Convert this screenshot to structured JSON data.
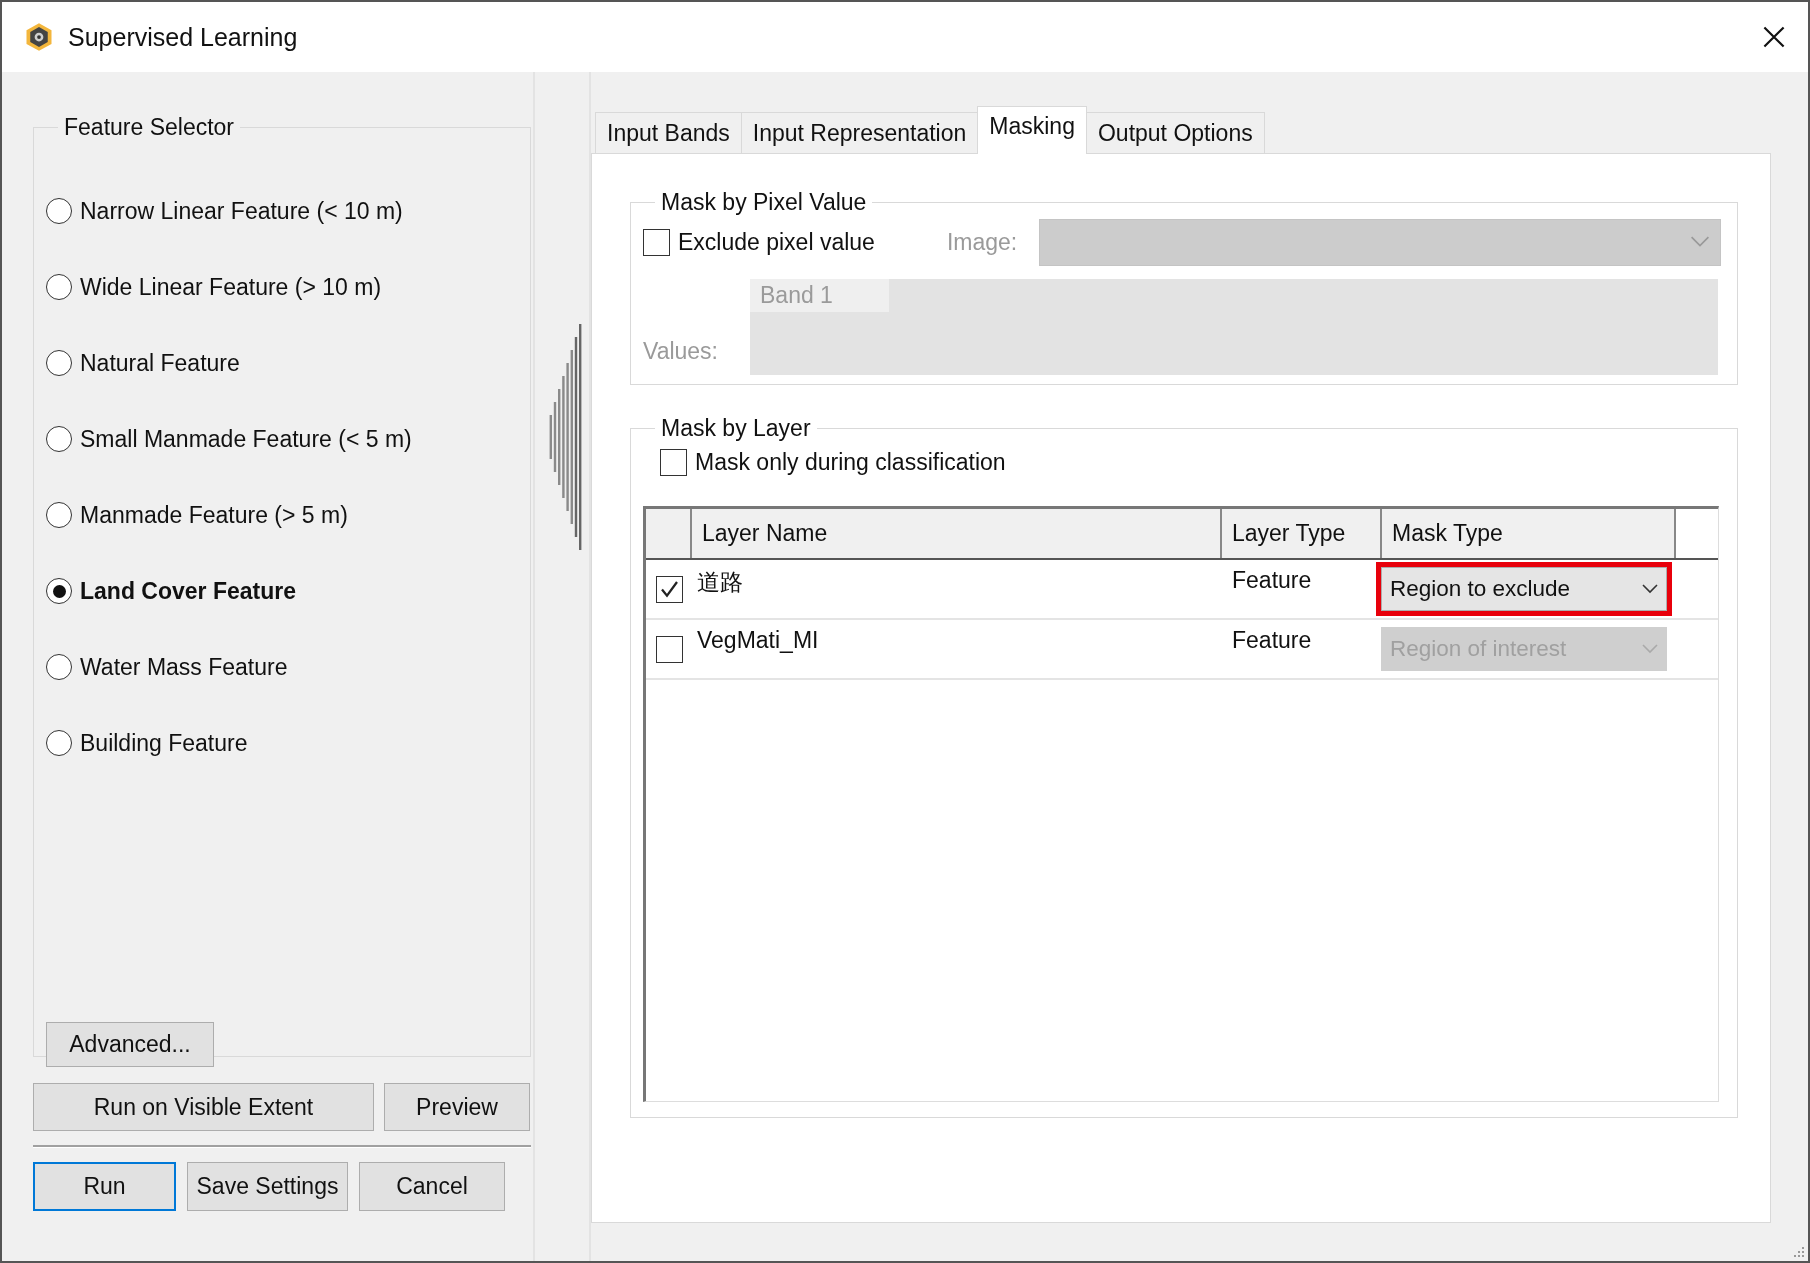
{
  "window": {
    "title": "Supervised Learning"
  },
  "feature_selector": {
    "title": "Feature Selector",
    "options": [
      {
        "label": "Narrow Linear Feature (< 10 m)",
        "selected": false
      },
      {
        "label": "Wide Linear Feature (> 10 m)",
        "selected": false
      },
      {
        "label": "Natural Feature",
        "selected": false
      },
      {
        "label": "Small Manmade Feature (< 5 m)",
        "selected": false
      },
      {
        "label": "Manmade Feature (> 5 m)",
        "selected": false
      },
      {
        "label": "Land Cover Feature",
        "selected": true
      },
      {
        "label": "Water Mass Feature",
        "selected": false
      },
      {
        "label": "Building Feature",
        "selected": false
      }
    ],
    "advanced_button": "Advanced..."
  },
  "action_buttons": [
    {
      "label": "Run on Visible Extent",
      "default": false
    },
    {
      "label": "Preview",
      "default": false
    }
  ],
  "dialog_buttons": [
    {
      "label": "Run",
      "default": true
    },
    {
      "label": "Save Settings",
      "default": false
    },
    {
      "label": "Cancel",
      "default": false
    }
  ],
  "tabs": [
    {
      "label": "Input Bands",
      "selected": false
    },
    {
      "label": "Input Representation",
      "selected": false
    },
    {
      "label": "Masking",
      "selected": true
    },
    {
      "label": "Output Options",
      "selected": false
    }
  ],
  "mask_by_pixel_value": {
    "title": "Mask by Pixel Value",
    "exclude_checkbox": {
      "label": "Exclude pixel value",
      "checked": false
    },
    "image": {
      "label": "Image:",
      "disabled": true
    },
    "values": {
      "label": "Values:",
      "column": "Band 1",
      "disabled": true
    }
  },
  "mask_by_layer": {
    "title": "Mask by Layer",
    "mask_only_checkbox": {
      "label": "Mask only during classification",
      "checked": false
    },
    "columns": [
      "Layer Name",
      "Layer Type",
      "Mask Type"
    ],
    "rows": [
      {
        "checked": true,
        "layer_name": "道路",
        "layer_type": "Feature",
        "mask_type": "Region to exclude",
        "mask_type_disabled": false,
        "highlighted": true
      },
      {
        "checked": false,
        "layer_name": "VegMati_MI",
        "layer_type": "Feature",
        "mask_type": "Region of interest",
        "mask_type_disabled": true,
        "highlighted": false
      }
    ]
  }
}
